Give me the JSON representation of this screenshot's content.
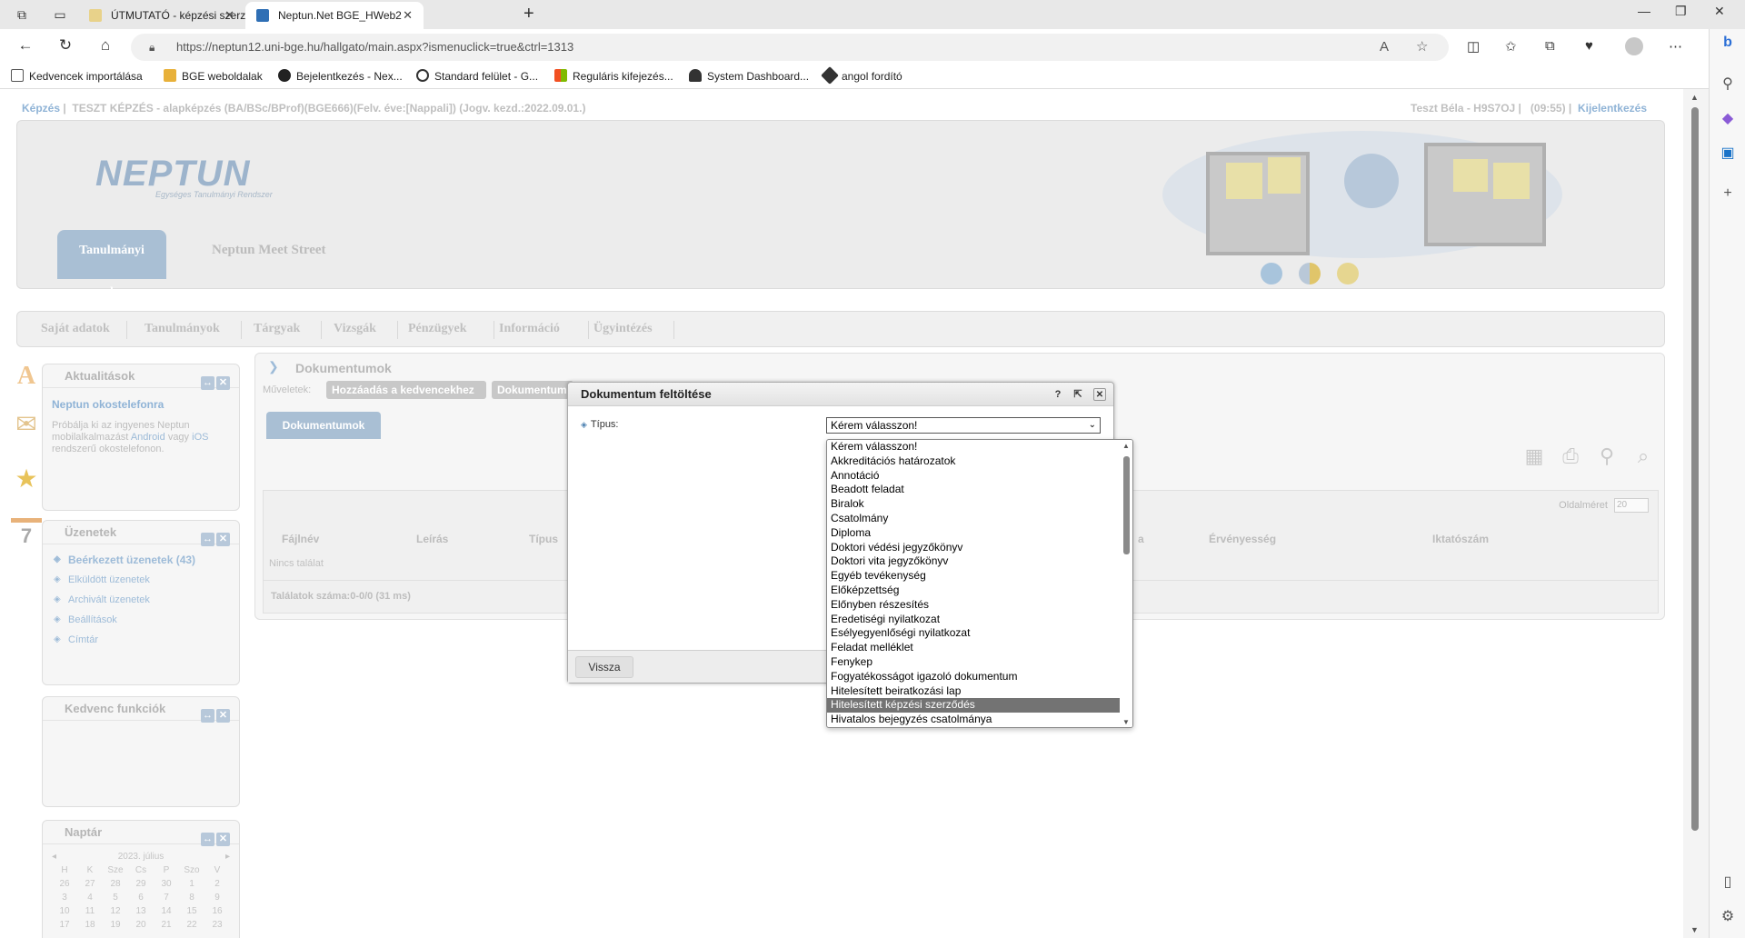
{
  "browser": {
    "tabs": [
      {
        "title": "ÚTMUTATÓ - képzési szerződés",
        "active": false
      },
      {
        "title": "Neptun.Net BGE_HWeb2",
        "active": true
      }
    ],
    "url": "https://neptun12.uni-bge.hu/hallgato/main.aspx?ismenuclick=true&ctrl=1313",
    "bookmarks": [
      {
        "label": "Kedvencek importálása",
        "color": "#555555"
      },
      {
        "label": "BGE weboldalak",
        "color": "#e8b13a"
      },
      {
        "label": "Bejelentkezés - Nex...",
        "color": "#222222"
      },
      {
        "label": "Standard felület - G...",
        "color": "#333333"
      },
      {
        "label": "Reguláris kifejezés...",
        "color": "#e44d26"
      },
      {
        "label": "System Dashboard...",
        "color": "#333333"
      },
      {
        "label": "angol fordító",
        "color": "#333333"
      }
    ]
  },
  "page": {
    "top_left_link": "Képzés",
    "top_left_text": "TESZT KÉPZÉS - alapképzés (BA/BSc/BProf)(BGE666)(Felv. éve:[Nappali]) (Jogv. kezd.:2022.09.01.)",
    "top_right_user": "Teszt Béla - H9S7OJ",
    "top_right_time": "(09:55)",
    "top_right_logout": "Kijelentkezés",
    "logo": "NEPTUN",
    "logo_sub": "Egységes Tanulmányi Rendszer",
    "system_tab": "Tanulmányi rendszer",
    "meet_street": "Neptun Meet Street",
    "menu": [
      "Saját adatok",
      "Tanulmányok",
      "Tárgyak",
      "Vizsgák",
      "Pénzügyek",
      "Információ",
      "Ügyintézés"
    ]
  },
  "sidebar": {
    "news": {
      "title": "Aktualitások",
      "headline": "Neptun okostelefonra",
      "text_1": "Próbálja ki az ingyenes Neptun mobilalkalmazást",
      "link_android": "Android",
      "text_2": "vagy",
      "link_ios": "iOS",
      "text_3": "rendszerű okostelefonon."
    },
    "messages": {
      "title": "Üzenetek",
      "items": [
        "Beérkezett üzenetek (43)",
        "Elküldött üzenetek",
        "Archivált üzenetek",
        "Beállítások",
        "Címtár"
      ]
    },
    "favorites": {
      "title": "Kedvenc funkciók"
    },
    "calendar": {
      "title": "Naptár",
      "month": "2023. július",
      "weekdays": [
        "H",
        "K",
        "Sze",
        "Cs",
        "P",
        "Szo",
        "V"
      ],
      "days": [
        "26",
        "27",
        "28",
        "29",
        "30",
        "1",
        "2",
        "3",
        "4",
        "5",
        "6",
        "7",
        "8",
        "9",
        "10",
        "11",
        "12",
        "13",
        "14",
        "15",
        "16",
        "17",
        "18",
        "19",
        "20",
        "21",
        "22",
        "23"
      ]
    }
  },
  "content": {
    "breadcrumb": "Dokumentumok",
    "ops_label": "Műveletek:",
    "op_buttons": [
      "Hozzáadás a kedvencekhez",
      "Dokumentum"
    ],
    "subtab": "Dokumentumok",
    "page_size_label": "Oldalméret",
    "page_size_value": "20",
    "columns": [
      "Fájlnév",
      "Leírás",
      "Típus",
      "a",
      "Érvényesség",
      "Iktatószám"
    ],
    "no_result": "Nincs találat",
    "result_count": "Találatok száma:0-0/0 (31 ms)"
  },
  "modal": {
    "title": "Dokumentum feltöltése",
    "field_label": "Típus:",
    "selected_value": "Kérem válasszon!",
    "back_button": "Vissza",
    "options": [
      "Kérem válasszon!",
      "Akkreditációs határozatok",
      "Annotáció",
      "Beadott feladat",
      "Biralok",
      "Csatolmány",
      "Diploma",
      "Doktori védési jegyzőkönyv",
      "Doktori vita jegyzőkönyv",
      "Egyéb tevékenység",
      "Előképzettség",
      "Előnyben részesítés",
      "Eredetiségi nyilatkozat",
      "Esélyegyenlőségi nyilatkozat",
      "Feladat melléklet",
      "Fenykep",
      "Fogyatékosságot igazoló dokumentum",
      "Hitelesített beiratkozási lap",
      "Hitelesített képzési szerződés",
      "Hivatalos bejegyzés csatolmánya"
    ],
    "highlighted_index": 18
  }
}
